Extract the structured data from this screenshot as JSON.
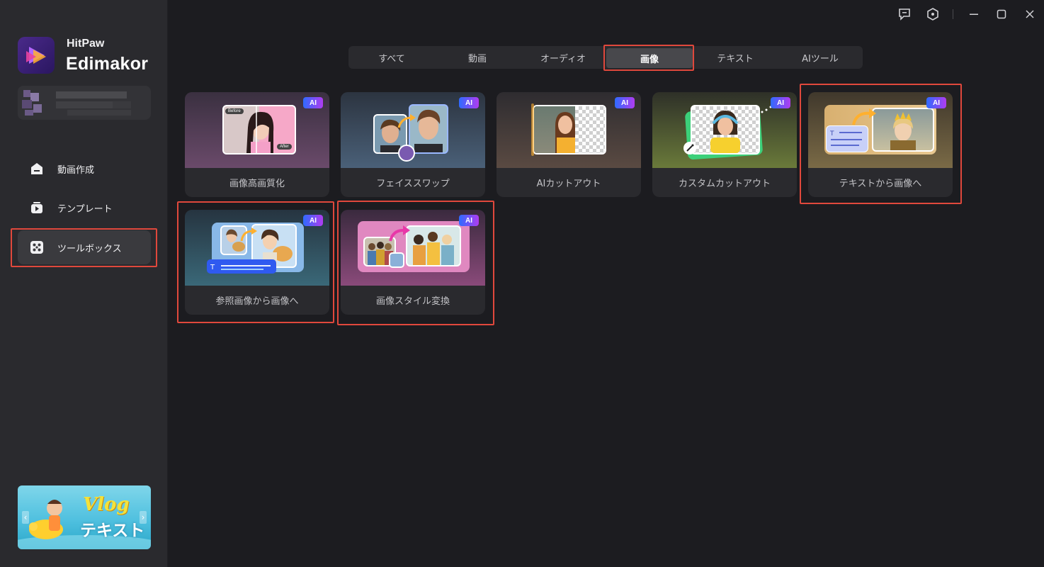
{
  "app": {
    "brand_top": "HitPaw",
    "brand_main": "Edimakor"
  },
  "sidebar": {
    "items": [
      {
        "label": "動画作成",
        "icon": "home-icon"
      },
      {
        "label": "テンプレート",
        "icon": "template-icon"
      },
      {
        "label": "ツールボックス",
        "icon": "toolbox-icon",
        "active": true
      }
    ],
    "banner": {
      "title": "Vlog",
      "subtitle": "テキスト"
    }
  },
  "window_controls": [
    "feedback-icon",
    "settings-icon",
    "minimize-icon",
    "maximize-icon",
    "close-icon"
  ],
  "tabs": [
    {
      "label": "すべて"
    },
    {
      "label": "動画"
    },
    {
      "label": "オーディオ"
    },
    {
      "label": "画像",
      "active": true
    },
    {
      "label": "テキスト"
    },
    {
      "label": "AIツール"
    }
  ],
  "cards": [
    {
      "title": "画像高画質化",
      "badge": "AI",
      "before_tag": "Before",
      "after_tag": "After"
    },
    {
      "title": "フェイススワップ",
      "badge": "AI"
    },
    {
      "title": "AIカットアウト",
      "badge": "AI"
    },
    {
      "title": "カスタムカットアウト",
      "badge": "AI"
    },
    {
      "title": "テキストから画像へ",
      "badge": "AI"
    },
    {
      "title": "参照画像から画像へ",
      "badge": "AI"
    },
    {
      "title": "画像スタイル変換",
      "badge": "AI"
    }
  ],
  "colors": {
    "highlight": "#e0483c",
    "background": "#1c1c20",
    "sidebar": "#2a2a2e",
    "ai_badge_start": "#2f6bff",
    "ai_badge_end": "#b03cf0"
  }
}
